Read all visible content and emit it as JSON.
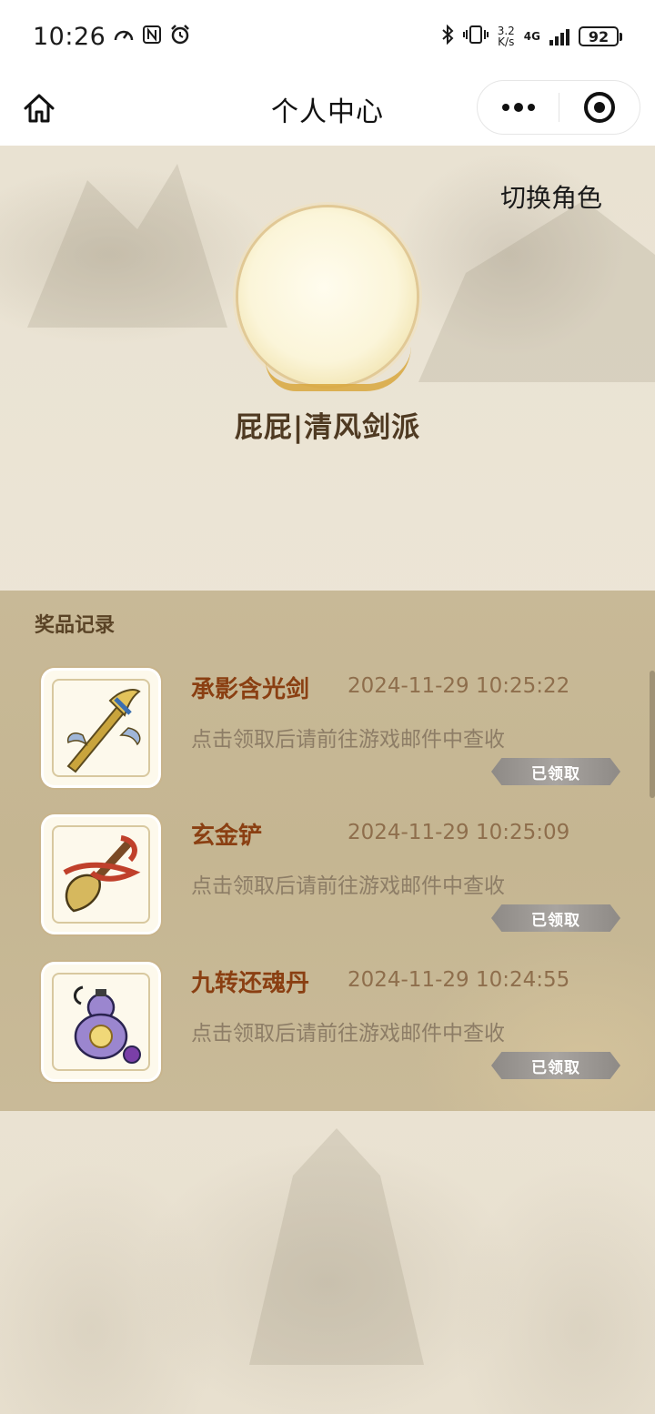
{
  "status_bar": {
    "time": "10:26",
    "net_speed": "3.2",
    "net_speed_unit": "K/s",
    "network": "4G",
    "battery": "92"
  },
  "title_bar": {
    "title": "个人中心"
  },
  "profile": {
    "switch_role_label": "切换角色",
    "username": "屁屁|清风剑派"
  },
  "prizes": {
    "section_title": "奖品记录",
    "items": [
      {
        "name": "承影含光剑",
        "time": "2024-11-29 10:25:22",
        "desc": "点击领取后请前往游戏邮件中查收",
        "status": "已领取",
        "icon": "sword-icon"
      },
      {
        "name": "玄金铲",
        "time": "2024-11-29 10:25:09",
        "desc": "点击领取后请前往游戏邮件中查收",
        "status": "已领取",
        "icon": "shovel-icon"
      },
      {
        "name": "九转还魂丹",
        "time": "2024-11-29 10:24:55",
        "desc": "点击领取后请前往游戏邮件中查收",
        "status": "已领取",
        "icon": "gourd-icon"
      }
    ]
  },
  "colors": {
    "item_name": "#8a3f12",
    "item_time": "#8e6e4c",
    "panel_bg": "#c7b894",
    "badge": "#9b9793"
  }
}
